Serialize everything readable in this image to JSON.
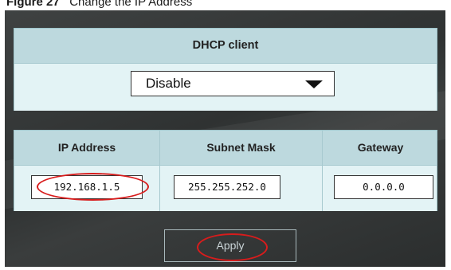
{
  "caption": {
    "figure_label": "Figure 27",
    "text": "Change the IP Address"
  },
  "dhcp": {
    "title": "DHCP client",
    "selected": "Disable"
  },
  "network": {
    "columns": [
      "IP Address",
      "Subnet Mask",
      "Gateway"
    ],
    "ip_address": "192.168.1.5",
    "subnet_mask": "255.255.252.0",
    "gateway": "0.0.0.0"
  },
  "apply_label": "Apply",
  "colors": {
    "highlight": "#d81c1c",
    "panel": "#2f3232",
    "header": "#bdd9de"
  }
}
